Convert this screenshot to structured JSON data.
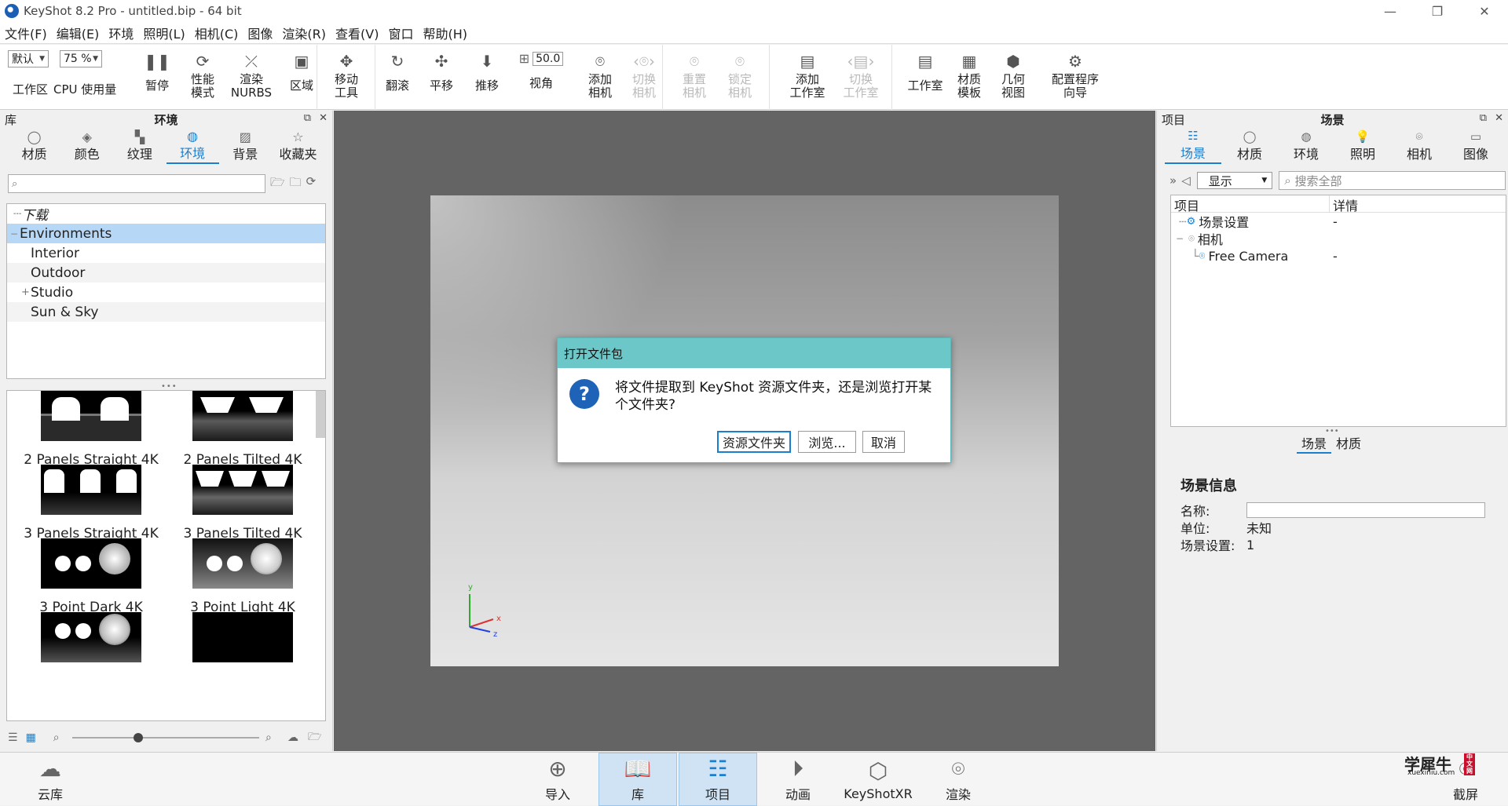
{
  "window": {
    "title": "KeyShot 8.2 Pro  -  untitled.bip  - 64 bit",
    "min": "—",
    "restore": "❐",
    "close": "✕"
  },
  "menu": [
    "文件(F)",
    "编辑(E)",
    "环境",
    "照明(L)",
    "相机(C)",
    "图像",
    "渲染(R)",
    "查看(V)",
    "窗口",
    "帮助(H)"
  ],
  "toolbar": {
    "workspace_select": "默认",
    "workspace_label": "工作区",
    "cpu_select": "75 %",
    "cpu_label": "CPU  使用量",
    "pause": "暂停",
    "perf_mode": "性能\n模式",
    "render_nurbs": "渲染\nNURBS",
    "region": "区域",
    "move_tool": "移动\n工具",
    "tumble": "翻滚",
    "pan": "平移",
    "dolly": "推移",
    "fov_value": "50.0",
    "fov_label": "视角",
    "add_camera": "添加\n相机",
    "switch_camera": "切换\n相机",
    "reset_camera": "重置\n相机",
    "lock_camera": "锁定\n相机",
    "add_studio": "添加\n工作室",
    "switch_studio": "切换\n工作室",
    "studio": "工作室",
    "material_template": "材质\n模板",
    "geometry_view": "几何\n视图",
    "config_wizard": "配置程序\n向导"
  },
  "library": {
    "title": "库",
    "section": "环境",
    "tabs": [
      "材质",
      "颜色",
      "纹理",
      "环境",
      "背景",
      "收藏夹"
    ],
    "active_tab": 3,
    "search_placeholder": "",
    "tree": [
      {
        "label": "下载",
        "italic": true
      },
      {
        "label": "Environments",
        "selected": true
      },
      {
        "label": "Interior"
      },
      {
        "label": "Outdoor"
      },
      {
        "label": "Studio",
        "expander": "+"
      },
      {
        "label": "Sun & Sky"
      }
    ],
    "thumbnails": [
      {
        "label": "2 Panels Straight 4K"
      },
      {
        "label": "2 Panels Tilted 4K"
      },
      {
        "label": "3 Panels Straight 4K"
      },
      {
        "label": "3 Panels Tilted 4K"
      },
      {
        "label": "3 Point Dark 4K"
      },
      {
        "label": "3 Point Light 4K"
      }
    ]
  },
  "viewport": {
    "axis": {
      "x": "x",
      "y": "y",
      "z": "z"
    }
  },
  "dialog": {
    "title": "打开文件包",
    "message": "将文件提取到 KeyShot 资源文件夹，还是浏览打开某个文件夹?",
    "btn_resources": "资源文件夹",
    "btn_browse": "浏览...",
    "btn_cancel": "取消"
  },
  "project": {
    "title": "项目",
    "section": "场景",
    "tabs": [
      "场景",
      "材质",
      "环境",
      "照明",
      "相机",
      "图像"
    ],
    "active_tab": 0,
    "display_select": "显示",
    "search_placeholder": "搜索全部",
    "columns": [
      "项目",
      "详情"
    ],
    "rows": [
      {
        "label": "场景设置",
        "detail": "-"
      },
      {
        "label": "相机",
        "detail": ""
      },
      {
        "label": "Free Camera",
        "detail": "-"
      }
    ],
    "detail_tabs": [
      "场景",
      "材质"
    ],
    "scene_info": {
      "heading": "场景信息",
      "name_label": "名称:",
      "name_value": "",
      "unit_label": "单位:",
      "unit_value": "未知",
      "setting_label": "场景设置:",
      "setting_value": "1"
    }
  },
  "bottombar": {
    "cloud": "云库",
    "import": "导入",
    "library": "库",
    "project": "项目",
    "animation": "动画",
    "keyshotxr": "KeyShotXR",
    "render": "渲染",
    "screenshot": "截屏"
  },
  "watermark": {
    "main": "学犀牛",
    "url": "xuexiniu.com",
    "seal": "中文网"
  }
}
